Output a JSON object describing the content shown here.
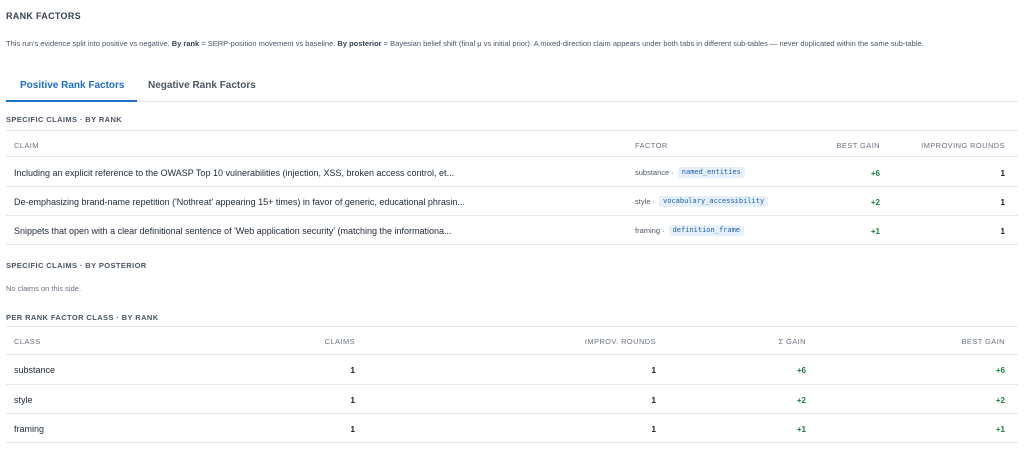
{
  "header": {
    "title": "RANK FACTORS",
    "desc_part1": "This run's evidence split into positive vs negative. ",
    "desc_bold1": "By rank",
    "desc_part2": " = SERP-position movement vs baseline. ",
    "desc_bold2": "By posterior",
    "desc_part3": " = Bayesian belief shift (final μ vs initial prior). A mixed-direction claim appears under both tabs in different sub-tables — never duplicated within the same sub-table."
  },
  "tabs": [
    {
      "label": "Positive Rank Factors",
      "active": true
    },
    {
      "label": "Negative Rank Factors",
      "active": false
    }
  ],
  "claims_by_rank": {
    "heading": "SPECIFIC CLAIMS · BY RANK",
    "columns": {
      "claim": "CLAIM",
      "factor": "FACTOR",
      "best_gain": "BEST GAIN",
      "improving_rounds": "IMPROVING ROUNDS"
    },
    "rows": [
      {
        "claim": "Including an explicit reference to the OWASP Top 10 vulnerabilities (injection, XSS, broken access control, et...",
        "factor_class": "substance ·",
        "factor_key": "named_entities",
        "best_gain": "+6",
        "improving_rounds": "1"
      },
      {
        "claim": "De-emphasizing brand-name repetition ('Nothreat' appearing 15+ times) in favor of generic, educational phrasin...",
        "factor_class": "style ·",
        "factor_key": "vocabulary_accessibility",
        "best_gain": "+2",
        "improving_rounds": "1"
      },
      {
        "claim": "Snippets that open with a clear definitional sentence of 'Web application security' (matching the informationa...",
        "factor_class": "framing ·",
        "factor_key": "definition_frame",
        "best_gain": "+1",
        "improving_rounds": "1"
      }
    ]
  },
  "claims_by_posterior": {
    "heading": "SPECIFIC CLAIMS · BY POSTERIOR",
    "empty_text": "No claims on this side."
  },
  "class_by_rank": {
    "heading": "PER RANK FACTOR CLASS · BY RANK",
    "columns": {
      "class": "CLASS",
      "claims": "CLAIMS",
      "improv_rounds": "IMPROV. ROUNDS",
      "sum_gain": "Σ GAIN",
      "best_gain": "BEST GAIN"
    },
    "rows": [
      {
        "class": "substance",
        "claims": "1",
        "improv_rounds": "1",
        "sum_gain": "+6",
        "best_gain": "+6"
      },
      {
        "class": "style",
        "claims": "1",
        "improv_rounds": "1",
        "sum_gain": "+2",
        "best_gain": "+2"
      },
      {
        "class": "framing",
        "claims": "1",
        "improv_rounds": "1",
        "sum_gain": "+1",
        "best_gain": "+1"
      }
    ]
  },
  "colors": {
    "accent": "#1d6fd0",
    "gain": "#15803d",
    "chip_bg": "#e6f0fb"
  }
}
